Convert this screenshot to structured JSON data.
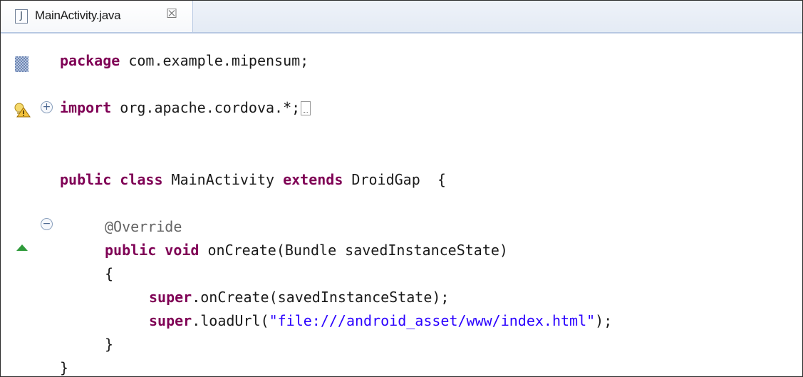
{
  "tab": {
    "icon": "java-file-icon",
    "icon_glyph": "J",
    "title": "MainActivity.java",
    "close_glyph": "☒"
  },
  "gutter": {
    "markers": [
      "task-marker-icon",
      "warning-lightbulb-icon",
      "override-triangle-icon"
    ]
  },
  "code": {
    "package_kw": "package",
    "package_name": " com.example.mipensum;",
    "import_kw": "import",
    "import_name": " org.apache.cordova.*;",
    "public_kw": "public",
    "class_kw": "class",
    "class_name": " MainActivity ",
    "extends_kw": "extends",
    "parent_class": " DroidGap  {",
    "annotation": "@Override",
    "method_public_kw": "public",
    "void_kw": "void",
    "method_sig": " onCreate(Bundle savedInstanceState)",
    "open_brace": "{",
    "super1_kw": "super",
    "super1_call": ".onCreate(savedInstanceState);",
    "super2_kw": "super",
    "super2_call": ".loadUrl(",
    "url_string": "\"file:///android_asset/www/index.html\"",
    "super2_end": ");",
    "close_brace_method": "}",
    "close_brace_class": "}"
  },
  "colors": {
    "keyword": "#7f0055",
    "string": "#2a00ff",
    "annotation": "#646464",
    "tab_border": "#b7c8e2"
  }
}
